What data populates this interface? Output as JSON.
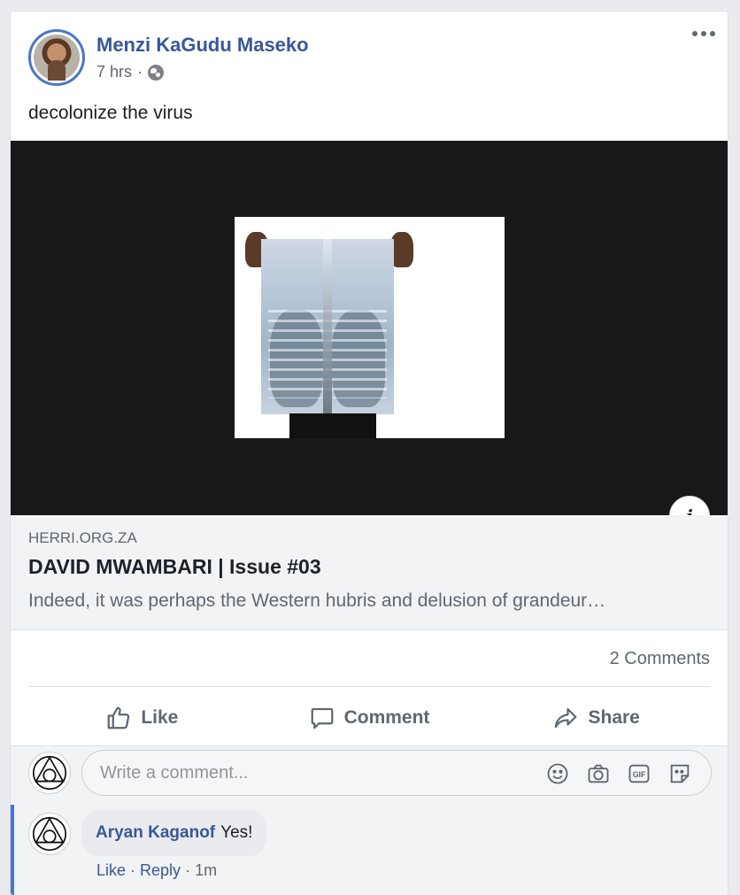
{
  "post": {
    "author": "Menzi KaGudu Maseko",
    "time": "7 hrs",
    "separator": "·",
    "message": "decolonize the virus"
  },
  "link_preview": {
    "domain": "HERRI.ORG.ZA",
    "title": "DAVID MWAMBARI | Issue #03",
    "description": "Indeed, it was perhaps the Western hubris and delusion of grandeur…",
    "info_label": "i"
  },
  "stats": {
    "comments": "2 Comments"
  },
  "actions": {
    "like": "Like",
    "comment": "Comment",
    "share": "Share"
  },
  "composer": {
    "placeholder": "Write a comment..."
  },
  "reply": {
    "author": "Aryan Kaganof",
    "text": "Yes!",
    "like": "Like",
    "sep1": "·",
    "reply": "Reply",
    "sep2": "·",
    "time": "1m"
  },
  "colors": {
    "link_blue": "#385898",
    "accent": "#4a76c9",
    "muted": "#606770"
  }
}
